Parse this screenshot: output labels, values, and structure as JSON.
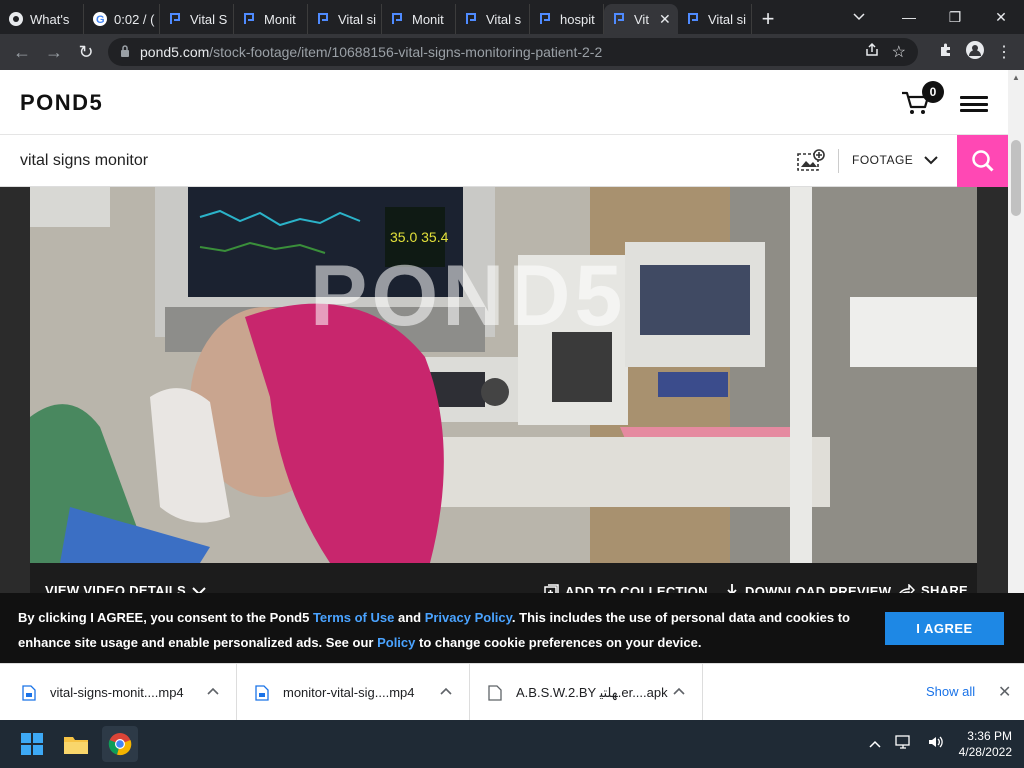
{
  "browser": {
    "tabs": [
      {
        "label": "What's",
        "icon": "chrome-icon"
      },
      {
        "label": "0:02 / (",
        "icon": "google-icon"
      },
      {
        "label": "Vital S",
        "icon": "pond5-icon"
      },
      {
        "label": "Monit",
        "icon": "pond5-icon"
      },
      {
        "label": "Vital si",
        "icon": "pond5-icon"
      },
      {
        "label": "Monit",
        "icon": "pond5-icon"
      },
      {
        "label": "Vital s",
        "icon": "pond5-icon"
      },
      {
        "label": "hospit",
        "icon": "pond5-icon"
      },
      {
        "label": "Vit",
        "icon": "pond5-icon",
        "active": true
      },
      {
        "label": "Vital si",
        "icon": "pond5-icon"
      }
    ],
    "url_host": "pond5.com",
    "url_path": "/stock-footage/item/10688156-vital-signs-monitoring-patient-2-2"
  },
  "header": {
    "logo": "POND5",
    "cart_count": "0"
  },
  "search": {
    "value": "vital signs monitor",
    "category": "FOOTAGE"
  },
  "video": {
    "watermark": "POND5",
    "view_details": "VIEW VIDEO DETAILS",
    "add_collection": "ADD TO COLLECTION",
    "download_preview": "DOWNLOAD PREVIEW",
    "share": "SHARE"
  },
  "cookie": {
    "text_1": "By clicking I AGREE, you consent to the Pond5 ",
    "terms_link": "Terms of Use",
    "text_2": " and ",
    "privacy_link": "Privacy Policy",
    "text_3": ". This includes the use of personal data and cookies to enhance site usage and enable personalized ads. See our ",
    "policy_link": "Policy",
    "text_4": " to change cookie preferences on your device.",
    "button": "I AGREE"
  },
  "downloads": {
    "items": [
      {
        "name": "vital-signs-monit....mp4"
      },
      {
        "name": "monitor-vital-sig....mp4"
      },
      {
        "name": "A.B.S.W.2.BY ﮭﻠﺘﯿ.er....apk"
      }
    ],
    "show_all": "Show all"
  },
  "taskbar": {
    "time": "3:36 PM",
    "date": "4/28/2022"
  },
  "colors": {
    "accent_pink": "#ff48b4",
    "agree_blue": "#1e88e5",
    "link_blue": "#4aa3ff"
  }
}
